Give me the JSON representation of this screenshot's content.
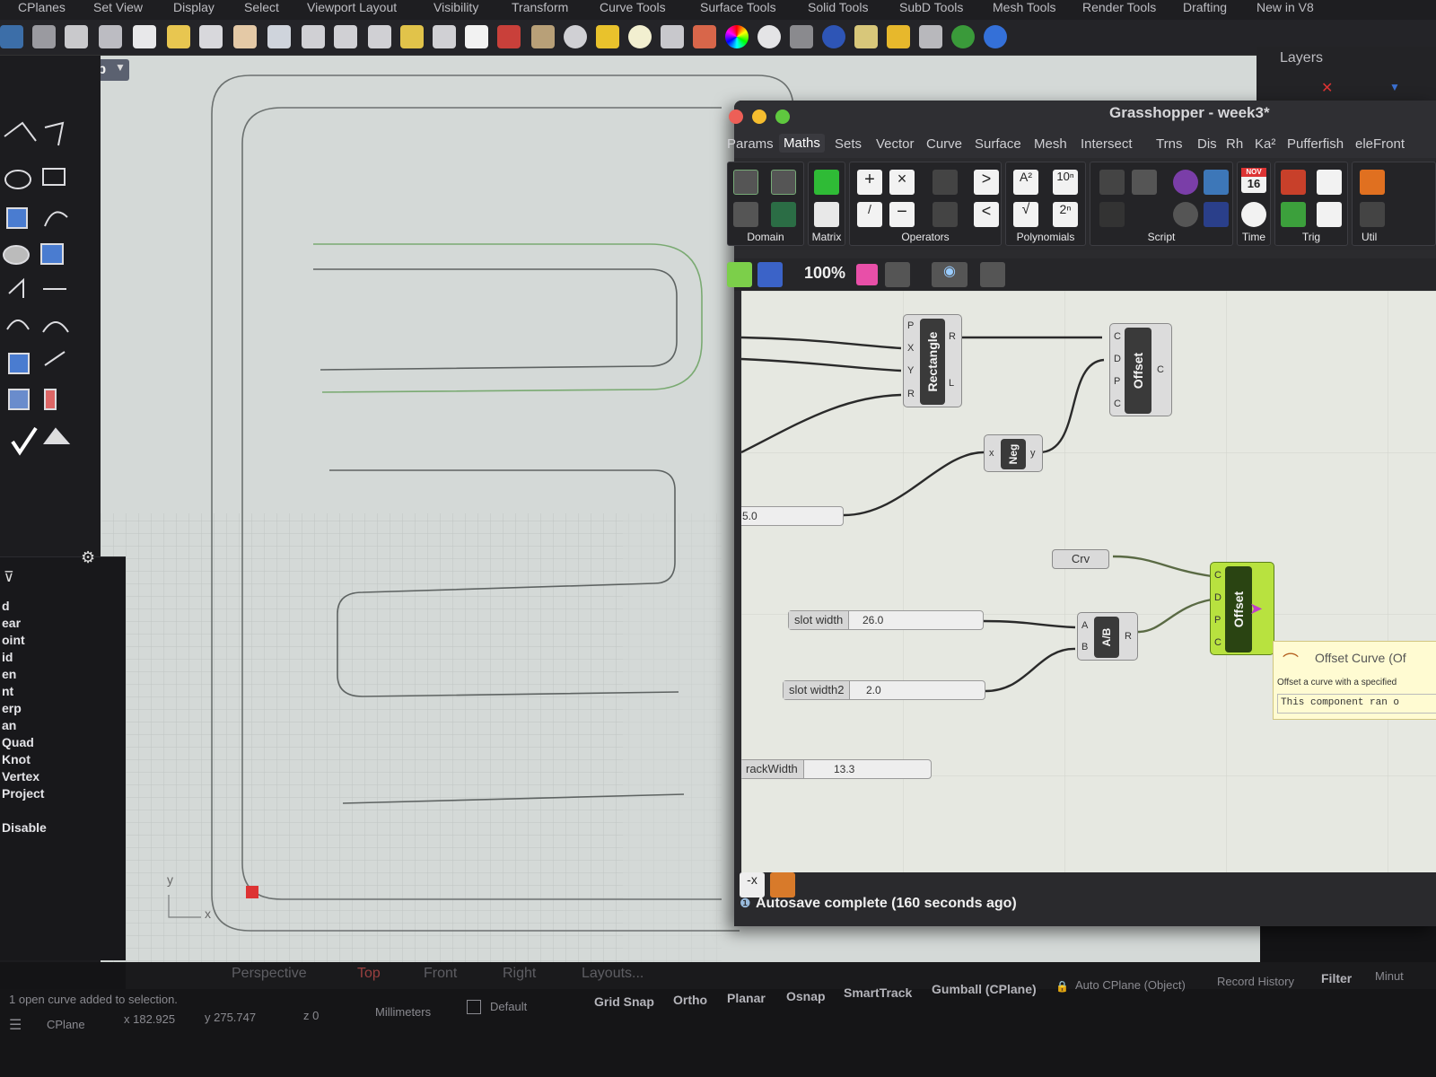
{
  "menu": [
    "CPlanes",
    "Set View",
    "Display",
    "Select",
    "Viewport Layout",
    "Visibility",
    "Transform",
    "Curve Tools",
    "Surface Tools",
    "Solid Tools",
    "SubD Tools",
    "Mesh Tools",
    "Render Tools",
    "Drafting",
    "New in V8"
  ],
  "viewport": {
    "title": "Top",
    "axis_x": "x",
    "axis_y": "y"
  },
  "layers_title": "Layers",
  "osnap_items": [
    "d",
    "ear",
    "oint",
    "id",
    "en",
    "nt",
    "erp",
    "an",
    "Quad",
    "Knot",
    "Vertex",
    "Project",
    "Disable"
  ],
  "grasshopper": {
    "title": "Grasshopper - week3*",
    "tabs": [
      "Params",
      "Maths",
      "Sets",
      "Vector",
      "Curve",
      "Surface",
      "Mesh",
      "Intersect",
      "Trns",
      "Dis",
      "Rh",
      "Ka²",
      "Pufferfish",
      "eleFront"
    ],
    "active_tab": "Maths",
    "ribbon_groups": [
      "Domain",
      "Matrix",
      "Operators",
      "Polynomials",
      "Script",
      "Time",
      "Trig",
      "Util"
    ],
    "calendar_month": "NOV",
    "calendar_day": "16",
    "zoom": "100%",
    "components": {
      "rectangle": {
        "name": "Rectangle",
        "inputs": [
          "P",
          "X",
          "Y",
          "R"
        ],
        "outputs": [
          "R",
          "L"
        ]
      },
      "offset1": {
        "name": "Offset",
        "inputs": [
          "C",
          "D",
          "P",
          "C"
        ],
        "outputs": [
          "C"
        ]
      },
      "neg": {
        "name": "Neg",
        "inputs": [
          "x"
        ],
        "outputs": [
          "y"
        ]
      },
      "ab": {
        "name": "A/B",
        "inputs": [
          "A",
          "B"
        ],
        "outputs": [
          "R"
        ]
      },
      "offset2": {
        "name": "Offset",
        "inputs": [
          "C",
          "D",
          "P",
          "C"
        ]
      },
      "crv": "Crv"
    },
    "sliders": [
      {
        "label": "",
        "value": "5.0"
      },
      {
        "label": "slot width",
        "value": "26.0"
      },
      {
        "label": "slot width2",
        "value": "2.0"
      },
      {
        "label": "rackWidth",
        "value": "13.3"
      }
    ],
    "tooltip": {
      "title": "Offset Curve (Of",
      "desc": "Offset a curve with a specified",
      "code": "This component ran o"
    },
    "status": "Autosave complete (160 seconds ago)"
  },
  "viewport_tabs": [
    "Perspective",
    "Top",
    "Front",
    "Right",
    "Layouts..."
  ],
  "command_message": "1 open curve added to selection.",
  "status": {
    "cplane": "CPlane",
    "x": "x 182.925",
    "y": "y 275.747",
    "z": "z 0",
    "units": "Millimeters",
    "layer": "Default",
    "toggles": [
      "Grid Snap",
      "Ortho",
      "Planar",
      "Osnap",
      "SmartTrack",
      "Gumball (CPlane)"
    ],
    "auto_cplane": "Auto CPlane (Object)",
    "record_history": "Record History",
    "filter": "Filter",
    "minutes": "Minut"
  },
  "colors": {
    "accent": "#c3e84a",
    "wire": "#2a2a2a",
    "viewport_bg": "#d4d9d7",
    "close": "#ed5f57",
    "minimize": "#f5bd2f",
    "maximize": "#5fc83f"
  }
}
